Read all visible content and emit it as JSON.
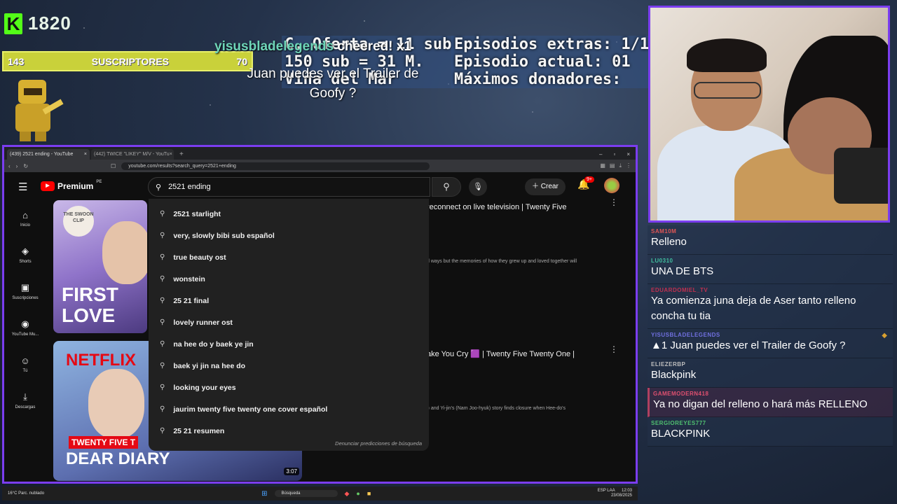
{
  "overlay": {
    "kick_count": "1820",
    "sub_left": "143",
    "sub_label": "SUSCRIPTORES",
    "sub_right": "70",
    "info_left": [
      "C. Oferta = 11 sub",
      "150 sub = 31 M.",
      "Viña del Mar"
    ],
    "info_right": [
      "Episodios extras: 1/1",
      "Episodio actual: 01",
      "Máximos donadores:"
    ]
  },
  "browser": {
    "tabs": [
      {
        "label": "(439) 2521 ending - YouTube",
        "close": "×"
      },
      {
        "label": "(442) TWICE \"LIKEY\" M/V - YouTu",
        "close": "×"
      }
    ],
    "new_tab": "+",
    "window_controls": [
      "–",
      "▫",
      "×"
    ],
    "url": "youtube.com/results?search_query=2521+ending"
  },
  "youtube": {
    "logo": "Premium",
    "region": "PE",
    "search_value": "2521 ending",
    "create_label": "Crear",
    "notif_badge": "9+",
    "sidebar": [
      {
        "icon": "home-icon",
        "glyph": "⌂",
        "label": "Inicio"
      },
      {
        "icon": "shorts-icon",
        "glyph": "◈",
        "label": "Shorts"
      },
      {
        "icon": "subscriptions-icon",
        "glyph": "▣",
        "label": "Suscripciones"
      },
      {
        "icon": "youtube-music-icon",
        "glyph": "◉",
        "label": "YouTube Mu..."
      },
      {
        "icon": "you-icon",
        "glyph": "☺",
        "label": "Tú"
      },
      {
        "icon": "downloads-icon",
        "glyph": "⤓",
        "label": "Descargas"
      }
    ],
    "suggestions": [
      "2521 starlight",
      "very, slowly bibi sub español",
      "true beauty ost",
      "wonstein",
      "25 21 final",
      "lovely runner ost",
      "na hee do y baek ye jin",
      "baek yi jin na hee do",
      "looking your eyes",
      "jaurim twenty five twenty one cover español",
      "25 21 resumen"
    ],
    "report_predictions": "Denunciar predicciones de búsqueda",
    "video1": {
      "title": "reconnect on live television | Twenty Five",
      "desc": "d ways but the memories of how they grew up and loved together will",
      "thumb_brand": "THE SWOON",
      "thumb_tag": "CLIP",
      "thumb_title": "FIRST LOVE"
    },
    "video2": {
      "title": "ake You Cry 🟪 | Twenty Five Twenty One |",
      "desc": "i) and Yi-jin's (Nam Joo-hyuk) story finds closure when Hee-do's",
      "thumb_brand": "NETFLIX",
      "thumb_tag": "TWENTY FIVE T",
      "thumb_title": "DEAR DIARY",
      "duration": "3:07"
    }
  },
  "alert": {
    "user": "yisusbladelegends",
    "cheer": "cheered! x1",
    "message": "Juan puedes ver el Trailer de Goofy ?"
  },
  "taskbar": {
    "weather": "16°C Parc. nublado",
    "search_placeholder": "Búsqueda",
    "lang": "ESP LAA",
    "time": "12:03",
    "date": "23/08/2025"
  },
  "chat": [
    {
      "user": "SAM10M",
      "color": "#e05555",
      "text": "Relleno",
      "hl": false
    },
    {
      "user": "LU0310",
      "color": "#40c0a0",
      "text": "UNA DE BTS",
      "hl": false
    },
    {
      "user": "EDUARDOMIEL_TV",
      "color": "#c03050",
      "text": "Ya comienza juna deja de Aser tanto relleno concha tu tia",
      "hl": false
    },
    {
      "user": "YISUSBLADELEGENDS",
      "color": "#7070e0",
      "text": "▲1 Juan puedes ver el Trailer de Goofy ?",
      "hl": false,
      "ticket": true
    },
    {
      "user": "ELIEZERBP",
      "color": "#bfbfbf",
      "text": "Blackpink",
      "hl": false
    },
    {
      "user": "GAMEMODERN418",
      "color": "#e05070",
      "text": "Ya no digan del relleno o hará más RELLENO",
      "hl": true
    },
    {
      "user": "SERGIOREYES777",
      "color": "#50c070",
      "text": "BLACKPINK",
      "hl": false
    }
  ]
}
